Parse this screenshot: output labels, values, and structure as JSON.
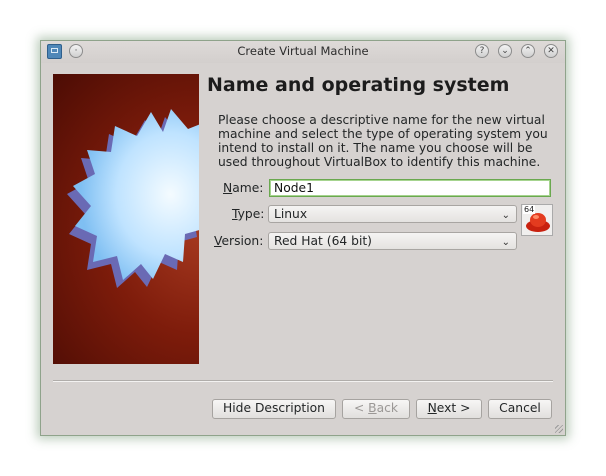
{
  "window": {
    "title": "Create Virtual Machine",
    "help_glyph": "?",
    "minimize_glyph": "⌄",
    "maximize_glyph": "⌃",
    "close_glyph": "✕",
    "menu_glyph": "·"
  },
  "page": {
    "heading": "Name and operating system",
    "description": "Please choose a descriptive name for the new virtual machine and select the type of operating system you intend to install on it. The name you choose will be used throughout VirtualBox to identify this machine."
  },
  "form": {
    "name_label_mnemonic": "N",
    "name_label_rest": "ame:",
    "name_value": "Node1",
    "type_label_mnemonic": "T",
    "type_label_rest": "ype:",
    "type_value": "Linux",
    "version_label_mnemonic": "V",
    "version_label_rest": "ersion:",
    "version_value": "Red Hat (64 bit)",
    "os_badge": "64"
  },
  "buttons": {
    "hide_description": "Hide Description",
    "back_prefix": "< ",
    "back_mnemonic": "B",
    "back_rest": "ack",
    "next_mnemonic": "N",
    "next_rest": "ext >",
    "cancel": "Cancel"
  },
  "colors": {
    "window_bg": "#d6d2d0",
    "input_focus_border": "#6aa84f",
    "wizard_image_red": "#7e1c0b",
    "star_blue": "#bfe3ff"
  }
}
